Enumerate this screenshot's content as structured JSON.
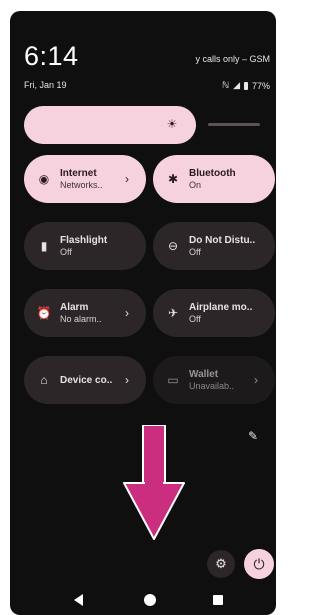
{
  "status": {
    "time": "6:14",
    "date": "Fri, Jan 19",
    "carrier": "y calls only – GSM",
    "battery": "77%",
    "icons": [
      "nfc-icon",
      "signal-icon",
      "battery-icon"
    ]
  },
  "brightness": {
    "level": 0.73,
    "icon": "brightness-icon"
  },
  "tiles": [
    {
      "label": "Internet",
      "sub": "Networks..",
      "state": "on",
      "icon": "wifi-icon",
      "chevron": true
    },
    {
      "label": "Bluetooth",
      "sub": "On",
      "state": "on",
      "icon": "bluetooth-icon",
      "chevron": false
    },
    {
      "label": "Flashlight",
      "sub": "Off",
      "state": "off",
      "icon": "flashlight-icon",
      "chevron": false
    },
    {
      "label": "Do Not Distu..",
      "sub": "Off",
      "state": "off",
      "icon": "do-not-disturb-icon",
      "chevron": false
    },
    {
      "label": "Alarm",
      "sub": "No alarm..",
      "state": "off",
      "icon": "alarm-icon",
      "chevron": true
    },
    {
      "label": "Airplane mo..",
      "sub": "Off",
      "state": "off",
      "icon": "airplane-icon",
      "chevron": false
    },
    {
      "label": "Device co..",
      "sub": "",
      "state": "off",
      "icon": "home-icon",
      "chevron": true
    },
    {
      "label": "Wallet",
      "sub": "Unavailab..",
      "state": "dim",
      "icon": "wallet-icon",
      "chevron": true
    }
  ],
  "colors": {
    "accent": "#f6d2de",
    "panel": "#0f0f0f",
    "tile_off": "#2c2628",
    "arrow": "#cc2e7f"
  },
  "nav": {
    "back": "back-icon",
    "home": "home-circle-icon",
    "recents": "recents-icon"
  }
}
